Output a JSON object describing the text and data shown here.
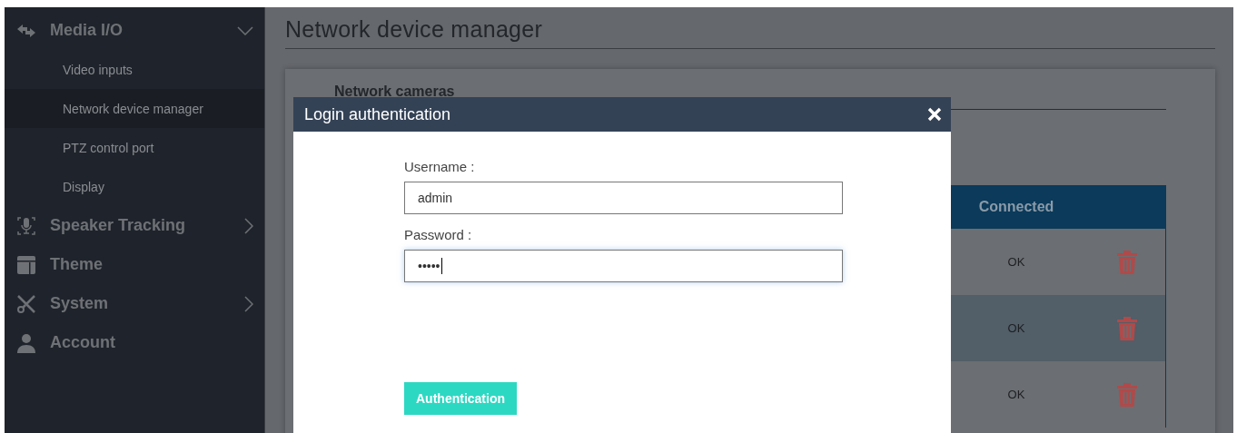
{
  "sidebar": {
    "items": [
      {
        "label": "Media I/O",
        "expanded": true,
        "children": [
          {
            "label": "Video inputs",
            "selected": false
          },
          {
            "label": "Network device manager",
            "selected": true
          },
          {
            "label": "PTZ control port",
            "selected": false
          },
          {
            "label": "Display",
            "selected": false
          }
        ]
      },
      {
        "label": "Speaker Tracking",
        "expanded": false
      },
      {
        "label": "Theme"
      },
      {
        "label": "System",
        "expanded": false
      },
      {
        "label": "Account"
      }
    ]
  },
  "page": {
    "title": "Network device manager",
    "section_title": "Network cameras",
    "table": {
      "columns": [
        "Connected"
      ],
      "rows": [
        {
          "connected": "OK",
          "selected": false
        },
        {
          "connected": "OK",
          "selected": true
        },
        {
          "connected": "OK",
          "selected": false
        }
      ]
    }
  },
  "dialog": {
    "title": "Login authentication",
    "fields": [
      {
        "label": "Username :",
        "value": "admin",
        "focused": false
      },
      {
        "label": "Password :",
        "value": "•••••",
        "focused": true
      }
    ],
    "button": "Authentication"
  }
}
